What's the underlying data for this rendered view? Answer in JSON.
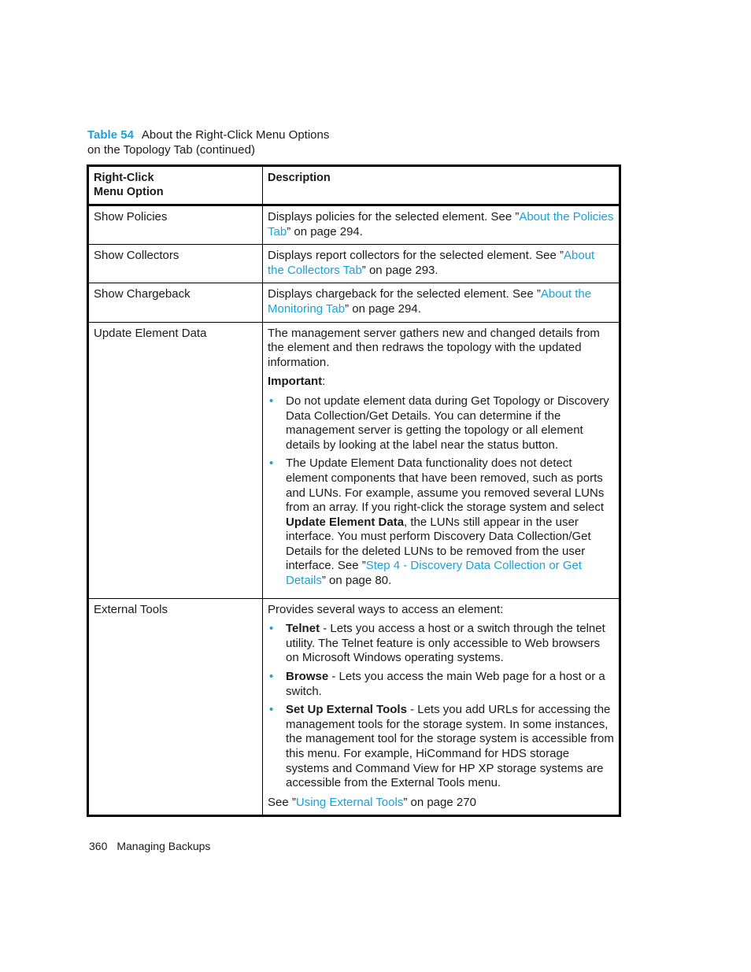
{
  "caption": {
    "table_number": "Table 54",
    "title_line1": "About the Right-Click Menu Options",
    "title_line2": "on the Topology Tab (continued)"
  },
  "table": {
    "headers": {
      "col1_line1": "Right-Click",
      "col1_line2": "Menu Option",
      "col2": "Description"
    },
    "rows": [
      {
        "option": "Show Policies",
        "pre": "Displays policies for the selected element. See ”",
        "link": "About the Policies Tab",
        "post": "” on page 294."
      },
      {
        "option": "Show Collectors",
        "pre": "Displays report collectors for the selected element. See ”",
        "link": "About the Collectors Tab",
        "post": "” on page 293."
      },
      {
        "option": "Show Chargeback",
        "pre": "Displays chargeback for the selected element. See ”",
        "link": "About the Monitoring Tab",
        "post": "” on page 294."
      },
      {
        "option": "Update Element Data",
        "intro": "The management server gathers new and changed details from the element and then redraws the topology with the updated information.",
        "important_label": "Important",
        "important_colon": ":",
        "bullets": [
          {
            "text": "Do not update element data during Get Topology or Discovery Data Collection/Get Details. You can determine if the management server is getting the topology or all element details by looking at the label near the status button."
          },
          {
            "pre": "The Update Element Data functionality does not detect element components that have been removed, such as ports and LUNs. For example, assume you removed several LUNs from an array. If you right-click the storage system and select ",
            "bold": "Update Element Data",
            "mid": ", the LUNs still appear in the user interface. You must perform Discovery Data Collection/Get Details for the deleted LUNs to be removed from the user interface. See ”",
            "link": "Step 4 - Discovery Data Collection or Get Details",
            "post": "” on page 80."
          }
        ]
      },
      {
        "option": "External Tools",
        "intro": "Provides several ways to access an element:",
        "bullets": [
          {
            "bold": "Telnet",
            "text": " - Lets you access a host or a switch through the telnet utility. The Telnet feature is only accessible to Web browsers on Microsoft Windows operating systems."
          },
          {
            "bold": "Browse",
            "text": " - Lets you access the main Web page for a host or a switch."
          },
          {
            "bold": "Set Up External Tools",
            "text": " - Lets you add URLs for accessing the management tools for the storage system. In some instances, the management tool for the storage system is accessible from this menu. For example, HiCommand for HDS storage systems and Command View for HP XP storage systems are accessible from the External Tools menu."
          }
        ],
        "see_pre": "See ”",
        "see_link": "Using External Tools",
        "see_post": "” on page 270"
      }
    ]
  },
  "bullet_glyph": "•",
  "footer": {
    "page_number": "360",
    "section": "Managing Backups"
  }
}
